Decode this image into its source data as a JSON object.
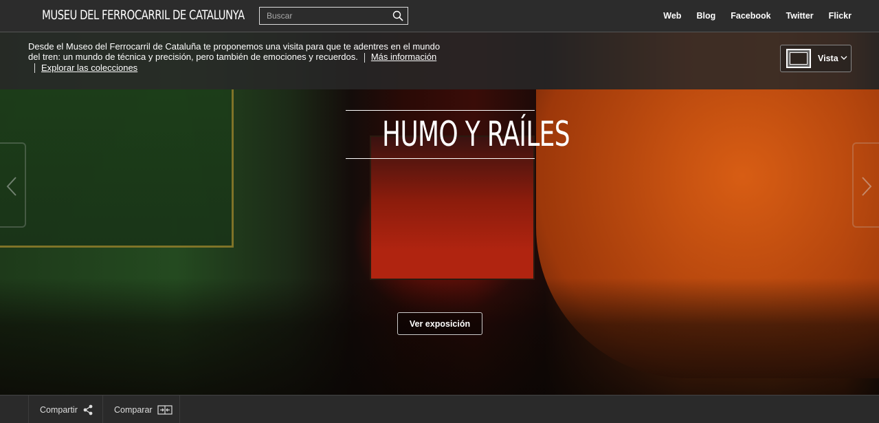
{
  "header": {
    "brand": "MUSEU DEL FERROCARRIL DE CATALUNYA",
    "search_placeholder": "Buscar",
    "nav": [
      "Web",
      "Blog",
      "Facebook",
      "Twitter",
      "Flickr"
    ]
  },
  "hero": {
    "intro_text": "Desde el Museo del Ferrocarril de Cataluña te proponemos una visita para que te adentres en el mundo del tren: un mundo de técnica y precisión, pero también de emociones y recuerdos.",
    "more_info_link": "Más información",
    "explore_link": "Explorar las colecciones",
    "view_label": "Vista",
    "title": "HUMO Y RAÍLES",
    "cta": "Ver exposición"
  },
  "footer": {
    "share_label": "Compartir",
    "compare_label": "Comparar"
  },
  "icons": {
    "search": "search-icon",
    "view": "view-frame-icon",
    "chevron": "chevron-down-icon",
    "prev": "chevron-left-icon",
    "next": "chevron-right-icon",
    "share": "share-icon",
    "compare": "compare-icon"
  }
}
